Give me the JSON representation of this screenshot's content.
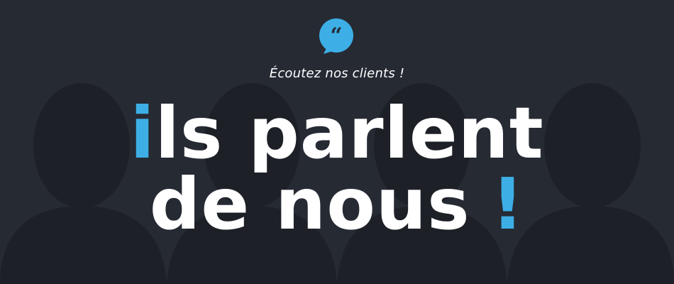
{
  "accent_color": "#3dafe6",
  "background_color": "#262a33",
  "silhouette_color": "#1d2027",
  "icon": "quote-speech-bubble-icon",
  "subtitle": "Écoutez nos clients !",
  "headline": {
    "line1": {
      "first_letter": "i",
      "rest": "ls parlent"
    },
    "line2": {
      "text": "de nous",
      "exclamation": "!"
    }
  }
}
